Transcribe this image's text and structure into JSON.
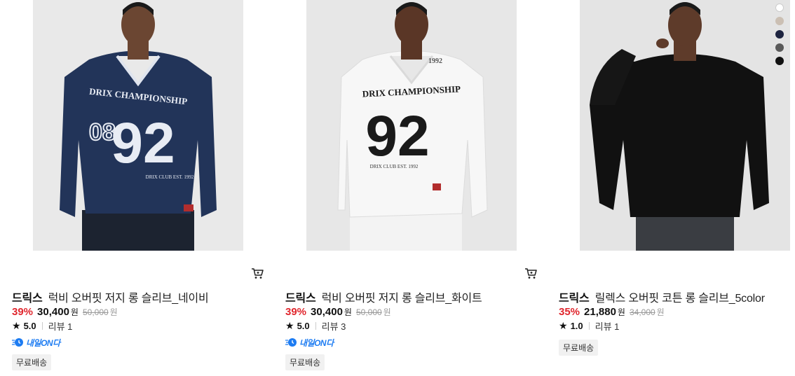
{
  "products": [
    {
      "brand": "드릭스",
      "name": "럭비 오버핏 저지 롱 슬리브_네이비",
      "discount": "39%",
      "price": "30,400",
      "currency": "원",
      "original_price": "50,000",
      "rating": "5.0",
      "review": "리뷰 1",
      "delivery_badge": "내일ON다",
      "tag": "무료배송",
      "shirt_color": "#223459",
      "print_color": "#e8ecf4",
      "bg_color": "#e9e9e9",
      "jersey_text": "DRIX CHAMPIONSHIP",
      "jersey_number": "92",
      "icon": "cart-icon"
    },
    {
      "brand": "드릭스",
      "name": "럭비 오버핏 저지 롱 슬리브_화이트",
      "discount": "39%",
      "price": "30,400",
      "currency": "원",
      "original_price": "50,000",
      "rating": "5.0",
      "review": "리뷰 3",
      "delivery_badge": "내일ON다",
      "tag": "무료배송",
      "shirt_color": "#f7f7f7",
      "print_color": "#1a1a1a",
      "bg_color": "#e7e7e7",
      "jersey_text": "DRIX CHAMPIONSHIP",
      "jersey_number": "92",
      "icon": "cart-icon"
    },
    {
      "brand": "드릭스",
      "name": "릴렉스 오버핏 코튼 롱 슬리브_5color",
      "discount": "35%",
      "price": "21,880",
      "currency": "원",
      "original_price": "34,000",
      "rating": "1.0",
      "review": "리뷰 1",
      "tag": "무료배송",
      "shirt_color": "#111111",
      "bg_color": "#e4e4e4",
      "swatches": [
        "#ffffff",
        "#cbbfb3",
        "#1e2440",
        "#5a5a5a",
        "#111111"
      ]
    }
  ],
  "accent_color": "#e0262d",
  "delivery_color": "#1d7cf2"
}
